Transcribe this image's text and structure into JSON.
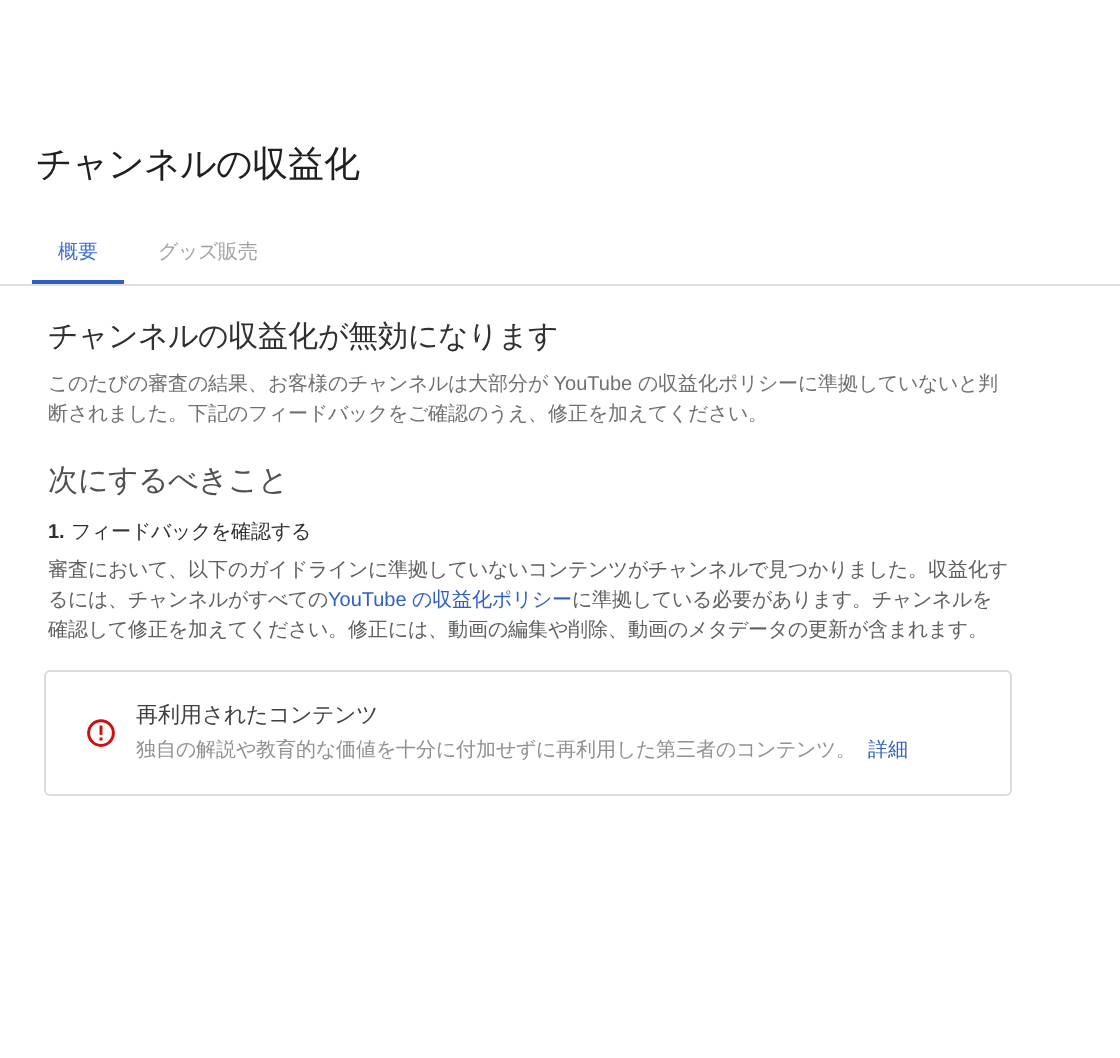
{
  "title": "チャンネルの収益化",
  "tabs": [
    {
      "label": "概要",
      "selected": true
    },
    {
      "label": "グッズ販売",
      "selected": false
    }
  ],
  "status": {
    "heading": "チャンネルの収益化が無効になります",
    "body": "このたびの審査の結果、お客様のチャンネルは大部分が YouTube の収益化ポリシーに準拠していないと判断されました。下記のフィードバックをご確認のうえ、修正を加えてください。"
  },
  "next_steps": {
    "heading": "次にするべきこと",
    "step": {
      "number": "1.",
      "title": "フィードバックを確認する",
      "body_before": "審査において、以下のガイドラインに準拠していないコンテンツがチャンネルで見つかりました。収益化するには、チャンネルがすべての",
      "link": "YouTube の収益化ポリシー",
      "body_after": "に準拠している必要があります。チャンネルを確認して修正を加えてください。修正には、動画の編集や削除、動画のメタデータの更新が含まれます。"
    }
  },
  "issues": [
    {
      "title": "再利用されたコンテンツ",
      "description": "独自の解説や教育的な価値を十分に付加せずに再利用した第三者のコンテンツ。",
      "link": "詳細"
    }
  ]
}
